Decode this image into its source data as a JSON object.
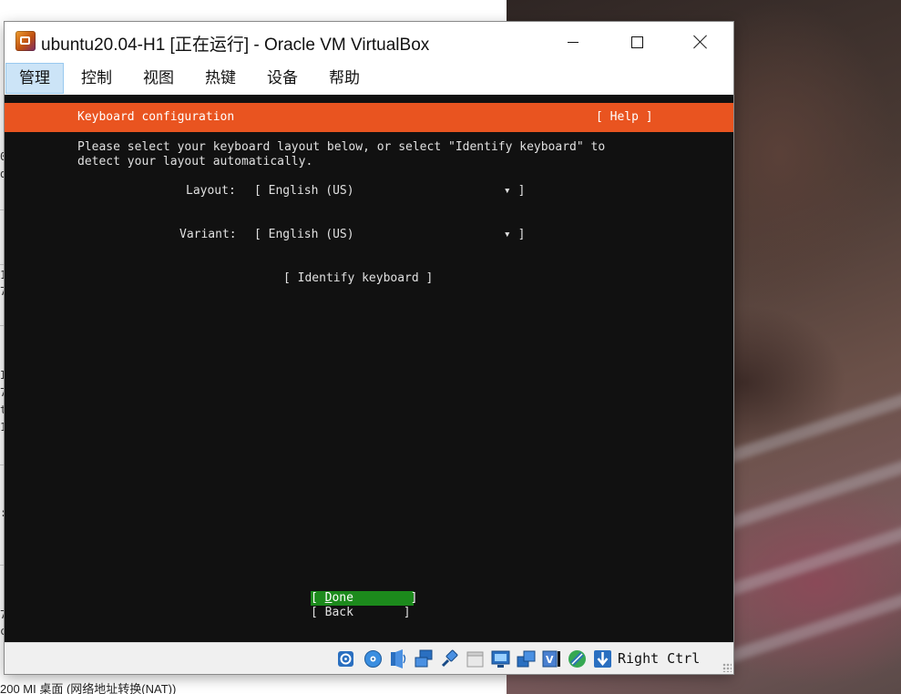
{
  "background": {
    "left_fragments": [
      "0",
      "d",
      "1",
      "7",
      "I",
      "7",
      "t",
      "1",
      ":",
      "7",
      "c"
    ],
    "bottom_text": "200 MI 桌面 (网络地址转换(NAT))"
  },
  "window": {
    "title": "ubuntu20.04-H1 [正在运行] - Oracle VM VirtualBox",
    "minimize_label": "",
    "maximize_label": "",
    "close_label": ""
  },
  "menu": {
    "items": [
      "管理",
      "控制",
      "视图",
      "热键",
      "设备",
      "帮助"
    ],
    "active_index": 0
  },
  "installer": {
    "header_title": "Keyboard configuration",
    "help_button": "[ Help ]",
    "description_line1": "Please select your keyboard layout below, or select \"Identify keyboard\" to",
    "description_line2": "detect your layout automatically.",
    "layout_label": "Layout:",
    "layout_value": "[ English (US)                     ▾ ]",
    "variant_label": "Variant:",
    "variant_value": "[ English (US)                     ▾ ]",
    "identify_button": "[ Identify keyboard ]",
    "done_button": {
      "prefix": "[ ",
      "hotkey": "D",
      "rest": "one        ]"
    },
    "back_button": "[ Back       ]"
  },
  "statusbar": {
    "icons": [
      "hard-disk-icon",
      "optical-drive-icon",
      "audio-icon",
      "network-icon",
      "usb-icon",
      "shared-folders-icon",
      "display-icon",
      "video-capture-icon",
      "virtualization-icon",
      "mouse-integration-icon",
      "keyboard-capture-icon"
    ],
    "host_key": "Right Ctrl"
  },
  "colors": {
    "ubuntu_orange": "#e95420",
    "done_green": "#1c8a1c",
    "terminal_bg": "#111111",
    "menu_active": "#cce4f7"
  }
}
